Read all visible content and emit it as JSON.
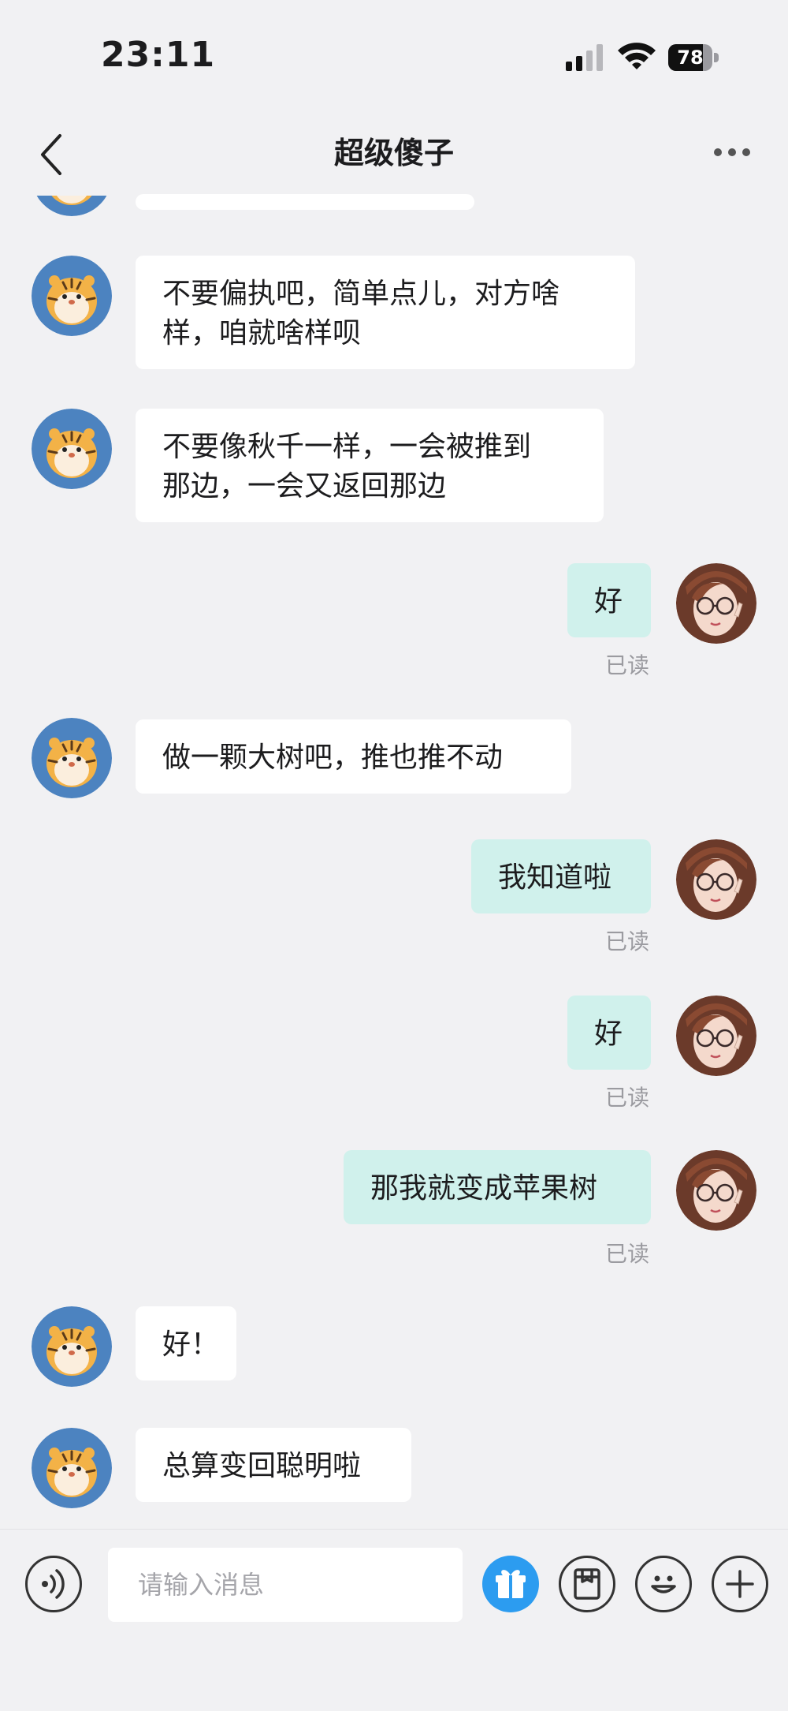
{
  "status_bar": {
    "time": "23:11",
    "battery": "78",
    "battery_level": 0.78
  },
  "header": {
    "title": "超级傻子"
  },
  "messages": [
    {
      "side": "in",
      "text": "不要偏执吧，简单点儿，对方啥\n样，咱就啥样呗"
    },
    {
      "side": "in",
      "text": "不要像秋千一样，一会被推到\n那边，一会又返回那边"
    },
    {
      "side": "out",
      "text": "好",
      "read": "已读"
    },
    {
      "side": "in",
      "text": "做一颗大树吧，推也推不动"
    },
    {
      "side": "out",
      "text": "我知道啦",
      "read": "已读"
    },
    {
      "side": "out",
      "text": "好",
      "read": "已读"
    },
    {
      "side": "out",
      "text": "那我就变成苹果树",
      "read": "已读"
    },
    {
      "side": "in",
      "text": "好！"
    },
    {
      "side": "in",
      "text": "总算变回聪明啦"
    }
  ],
  "input_bar": {
    "placeholder": "请输入消息"
  },
  "colors": {
    "background": "#f1f1f3",
    "incoming_bubble": "#ffffff",
    "outgoing_bubble": "#d0f1ec",
    "gift_accent": "#2c9cf0",
    "read_text": "#9b9ba0"
  }
}
